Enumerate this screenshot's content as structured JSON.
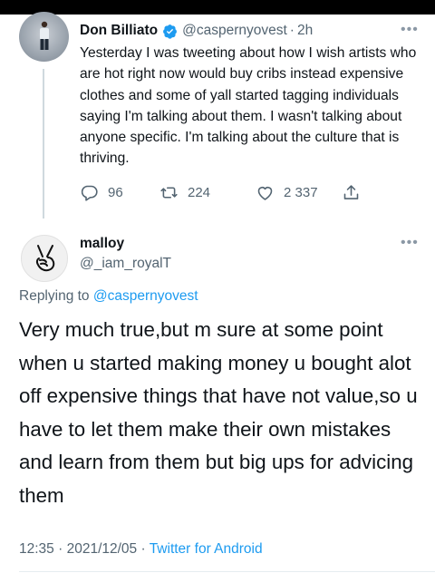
{
  "original_tweet": {
    "display_name": "Don Billiato",
    "handle": "@caspernyovest",
    "separator": "·",
    "time": "2h",
    "more": "•••",
    "text": "Yesterday I was tweeting about how I wish artists who are hot right now would buy cribs instead expensive clothes and some of yall started tagging individuals saying I'm talking about them. I wasn't talking about anyone specific. I'm talking about the culture that is thriving.",
    "replies": "96",
    "retweets": "224",
    "likes": "2 337"
  },
  "reply_tweet": {
    "display_name": "malloy",
    "handle": "@_iam_royalT",
    "more": "•••",
    "replying_prefix": "Replying to",
    "replying_mention": "@caspernyovest",
    "text": "Very much true,but m sure  at some point when u started making money u bought alot off expensive things that have not value,so u have to let them make their own mistakes and learn from them but big ups for advicing them",
    "time": "12:35",
    "separator": "·",
    "date": "2021/12/05",
    "separator2": "·",
    "source": "Twitter for Android"
  },
  "colors": {
    "accent": "#1d9bf0",
    "secondary_text": "#536471",
    "primary_text": "#0f1419"
  },
  "icons": [
    "verified-badge-icon",
    "reply-icon",
    "retweet-icon",
    "like-icon",
    "share-icon",
    "more-icon",
    "victory-hand-icon"
  ]
}
